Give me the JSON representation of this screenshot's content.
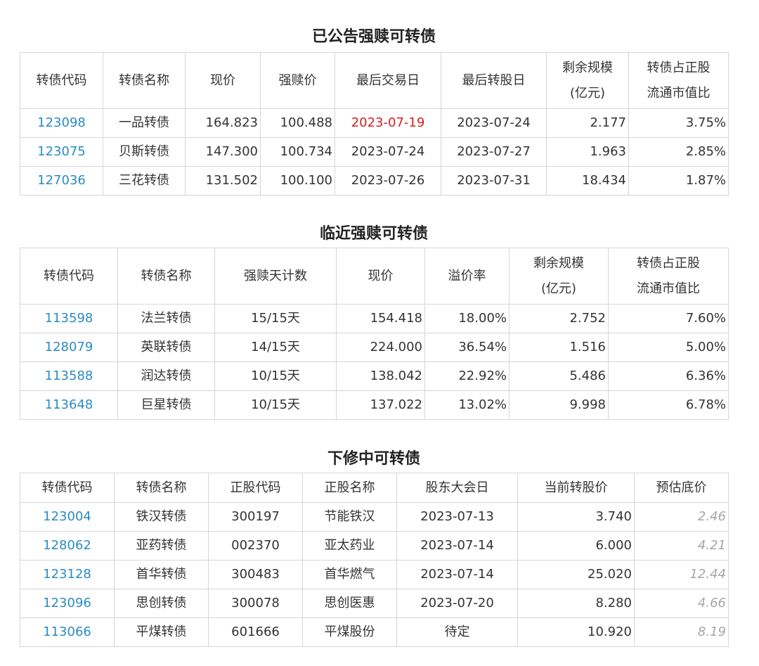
{
  "announced": {
    "title": "已公告强赎可转债",
    "headers": [
      "转债代码",
      "转债名称",
      "现价",
      "强赎价",
      "最后交易日",
      "最后转股日"
    ],
    "header_scale": [
      "剩余规模",
      "(亿元)"
    ],
    "header_ratio": [
      "转债占正股",
      "流通市值比"
    ],
    "rows": [
      {
        "code": "123098",
        "name": "一品转债",
        "price": "164.823",
        "redeem_price": "100.488",
        "last_trade": "2023-07-19",
        "last_convert": "2023-07-24",
        "scale": "2.177",
        "ratio": "3.75%"
      },
      {
        "code": "123075",
        "name": "贝斯转债",
        "price": "147.300",
        "redeem_price": "100.734",
        "last_trade": "2023-07-24",
        "last_convert": "2023-07-27",
        "scale": "1.963",
        "ratio": "2.85%"
      },
      {
        "code": "127036",
        "name": "三花转债",
        "price": "131.502",
        "redeem_price": "100.100",
        "last_trade": "2023-07-26",
        "last_convert": "2023-07-31",
        "scale": "18.434",
        "ratio": "1.87%"
      }
    ],
    "highlight_color": "#d81e1e"
  },
  "approaching": {
    "title": "临近强赎可转债",
    "headers": [
      "转债代码",
      "转债名称",
      "强赎天计数",
      "现价",
      "溢价率"
    ],
    "header_scale": [
      "剩余规模",
      "(亿元)"
    ],
    "header_ratio": [
      "转债占正股",
      "流通市值比"
    ],
    "rows": [
      {
        "code": "113598",
        "name": "法兰转债",
        "days": "15/15天",
        "price": "154.418",
        "premium": "18.00%",
        "scale": "2.752",
        "ratio": "7.60%"
      },
      {
        "code": "128079",
        "name": "英联转债",
        "days": "14/15天",
        "price": "224.000",
        "premium": "36.54%",
        "scale": "1.516",
        "ratio": "5.00%"
      },
      {
        "code": "113588",
        "name": "润达转债",
        "days": "10/15天",
        "price": "138.042",
        "premium": "22.92%",
        "scale": "5.486",
        "ratio": "6.36%"
      },
      {
        "code": "113648",
        "name": "巨星转债",
        "days": "10/15天",
        "price": "137.022",
        "premium": "13.02%",
        "scale": "9.998",
        "ratio": "6.78%"
      }
    ]
  },
  "revising": {
    "title": "下修中可转债",
    "headers": [
      "转债代码",
      "转债名称",
      "正股代码",
      "正股名称",
      "股东大会日",
      "当前转股价",
      "预估底价"
    ],
    "rows": [
      {
        "code": "123004",
        "name": "铁汉转债",
        "stock_code": "300197",
        "stock_name": "节能铁汉",
        "meeting": "2023-07-13",
        "convert_price": "3.740",
        "est_floor": "2.46"
      },
      {
        "code": "128062",
        "name": "亚药转债",
        "stock_code": "002370",
        "stock_name": "亚太药业",
        "meeting": "2023-07-14",
        "convert_price": "6.000",
        "est_floor": "4.21"
      },
      {
        "code": "123128",
        "name": "首华转债",
        "stock_code": "300483",
        "stock_name": "首华燃气",
        "meeting": "2023-07-14",
        "convert_price": "25.020",
        "est_floor": "12.44"
      },
      {
        "code": "123096",
        "name": "思创转债",
        "stock_code": "300078",
        "stock_name": "思创医惠",
        "meeting": "2023-07-20",
        "convert_price": "8.280",
        "est_floor": "4.66"
      },
      {
        "code": "113066",
        "name": "平煤转债",
        "stock_code": "601666",
        "stock_name": "平煤股份",
        "meeting": "待定",
        "convert_price": "10.920",
        "est_floor": "8.19"
      }
    ]
  },
  "colors": {
    "code_link": "#2b8bc2",
    "estimate": "#a6a6a6",
    "border": "#d6d6d6"
  }
}
